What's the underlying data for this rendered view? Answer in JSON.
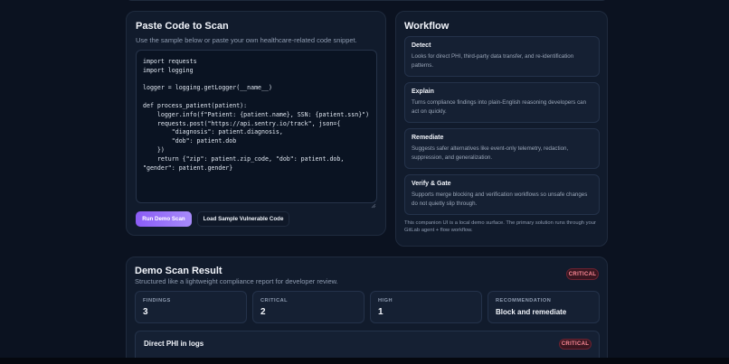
{
  "scan": {
    "title": "Paste Code to Scan",
    "subtitle": "Use the sample below or paste your own healthcare-related code snippet.",
    "code": "import requests\nimport logging\n\nlogger = logging.getLogger(__name__)\n\ndef process_patient(patient):\n    logger.info(f\"Patient: {patient.name}, SSN: {patient.ssn}\")\n    requests.post(\"https://api.sentry.io/track\", json={\n        \"diagnosis\": patient.diagnosis,\n        \"dob\": patient.dob\n    })\n    return {\"zip\": patient.zip_code, \"dob\": patient.dob, \"gender\": patient.gender}",
    "run_button": "Run Demo Scan",
    "load_button": "Load Sample Vulnerable Code"
  },
  "workflow": {
    "title": "Workflow",
    "steps": [
      {
        "title": "Detect",
        "desc": "Looks for direct PHI, third-party data transfer, and re-identification patterns."
      },
      {
        "title": "Explain",
        "desc": "Turns compliance findings into plain-English reasoning developers can act on quickly."
      },
      {
        "title": "Remediate",
        "desc": "Suggests safer alternatives like event-only telemetry, redaction, suppression, and generalization."
      },
      {
        "title": "Verify & Gate",
        "desc": "Supports merge blocking and verification workflows so unsafe changes do not quietly slip through."
      }
    ],
    "note": "This companion UI is a local demo surface. The primary solution runs through your GitLab agent + flow workflow."
  },
  "result": {
    "title": "Demo Scan Result",
    "subtitle": "Structured like a lightweight compliance report for developer review.",
    "badge": "CRITICAL",
    "stats": [
      {
        "label": "FINDINGS",
        "value": "3"
      },
      {
        "label": "CRITICAL",
        "value": "2"
      },
      {
        "label": "HIGH",
        "value": "1"
      },
      {
        "label": "RECOMMENDATION",
        "value": "Block and remediate"
      }
    ],
    "finding": {
      "title": "Direct PHI in logs",
      "badge": "CRITICAL"
    }
  },
  "colors": {
    "background": "#0b1220",
    "card": "#111b2c",
    "accent": "#8b5cf6",
    "critical": "#ff8a98"
  }
}
